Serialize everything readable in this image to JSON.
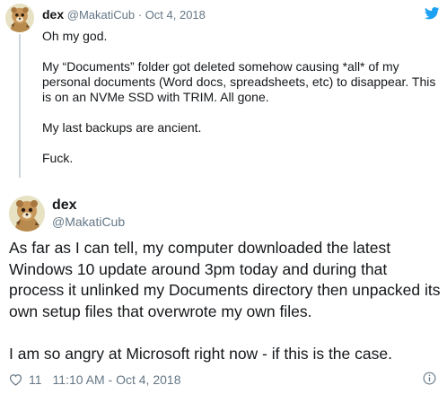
{
  "quoted_tweet": {
    "name": "dex",
    "handle": "@MakatiCub",
    "separator": "·",
    "date": "Oct 4, 2018",
    "paragraphs": [
      "Oh my god.",
      "My “Documents” folder got deleted somehow causing *all* of my personal documents (Word docs, spreadsheets, etc) to disappear. This is on an NVMe SSD with TRIM. All gone.",
      "My last backups are ancient.",
      "Fuck."
    ]
  },
  "main_tweet": {
    "name": "dex",
    "handle": "@MakatiCub",
    "paragraphs": [
      "As far as I can tell, my computer downloaded the latest Windows 10 update around 3pm today and during that process it unlinked my Documents directory then unpacked its own setup files that overwrote my own files.",
      "I am so angry at Microsoft right now - if this is the case."
    ],
    "like_count": "11",
    "timestamp": "11:10 AM - Oct 4, 2018"
  },
  "icons": {
    "twitter": "twitter-bird-icon",
    "like": "heart-icon",
    "info": "info-icon"
  },
  "colors": {
    "twitter_blue": "#1da1f2",
    "text": "#14171a",
    "secondary": "#657786",
    "thread_line": "#ccd6dd"
  }
}
